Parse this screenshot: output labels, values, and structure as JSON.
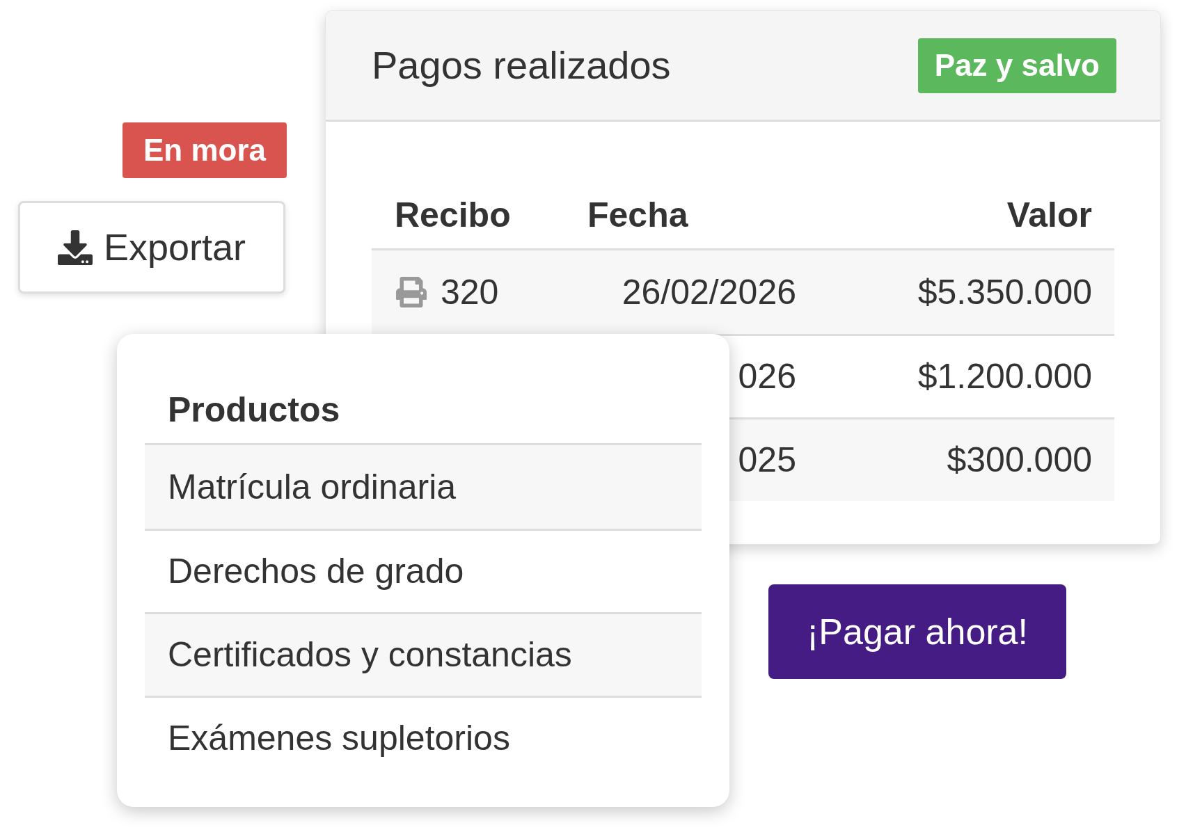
{
  "payments_card": {
    "title": "Pagos realizados",
    "status_badge": "Paz y salvo",
    "table": {
      "columns": [
        "Recibo",
        "Fecha",
        "Valor"
      ],
      "rows": [
        {
          "receipt": "320",
          "date": "26/02/2026",
          "value": "$5.350.000"
        },
        {
          "date": "026",
          "value": "$1.200.000"
        },
        {
          "date": "025",
          "value": "$300.000"
        }
      ]
    }
  },
  "overdue_badge": "En mora",
  "export_button": "Exportar",
  "products_card": {
    "title": "Productos",
    "items": [
      "Matrícula ordinaria",
      "Derechos de grado",
      "Certificados y constancias",
      "Exámenes supletorios"
    ]
  },
  "pay_button": "¡Pagar ahora!"
}
